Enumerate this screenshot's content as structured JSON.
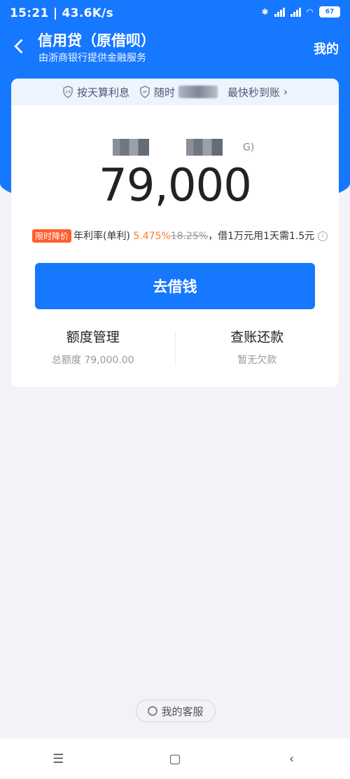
{
  "status": {
    "time": "15:21 | 43.6K/s",
    "battery": "67"
  },
  "header": {
    "title": "信用贷（原借呗）",
    "subtitle": "由浙商银行提供金融服务",
    "mine": "我的"
  },
  "perks": {
    "item1": "按天算利息",
    "item2": "随时",
    "item3": "最快秒到账"
  },
  "credit": {
    "suffix": "G)",
    "amount": "79,000"
  },
  "rate": {
    "badge": "限时降价",
    "label": "年利率(单利)",
    "new_rate": "5.475%",
    "old_rate": "18.25%",
    "desc": "，借1万元用1天需1.5元"
  },
  "borrow_button": "去借钱",
  "tools": {
    "left_title": "额度管理",
    "left_sub": "总额度 79,000.00",
    "right_title": "查账还款",
    "right_sub": "暂无欠款"
  },
  "service": "我的客服",
  "nav": {
    "menu": "☰",
    "home": "▢",
    "back": "‹"
  },
  "colors": {
    "primary": "#1677ff",
    "accent": "#ff7b2b",
    "badge": "#ff5d2c"
  }
}
